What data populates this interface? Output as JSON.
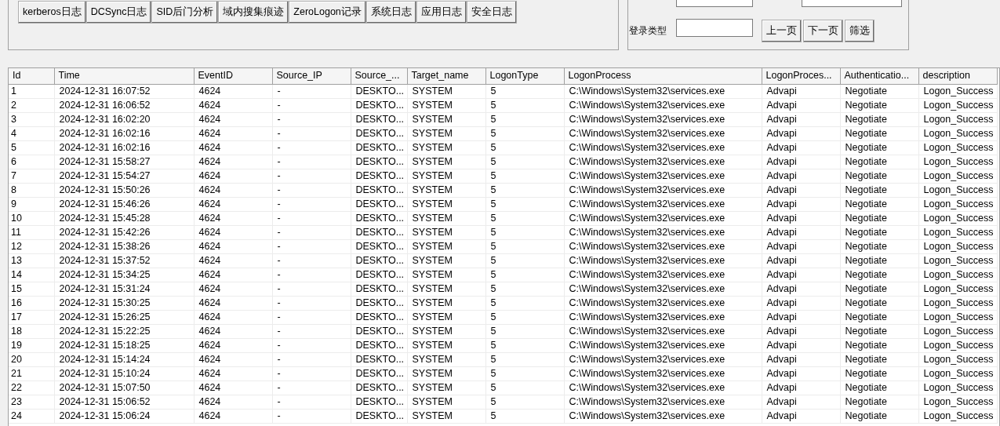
{
  "log_buttons": [
    "kerberos日志",
    "DCSync日志",
    "SID后门分析",
    "域内搜集痕迹",
    "ZeroLogon记录",
    "系统日志",
    "应用日志",
    "安全日志"
  ],
  "filter": {
    "logon_type_label": "登录类型",
    "buttons": [
      "上一页",
      "下一页",
      "筛选"
    ]
  },
  "table": {
    "columns": [
      "Id",
      "Time",
      "EventID",
      "Source_IP",
      "Source_...",
      "Target_name",
      "LogonType",
      "LogonProcess",
      "LogonProces...",
      "Authenticatio...",
      "description"
    ],
    "rows": [
      [
        "1",
        "2024-12-31 16:07:52",
        "4624",
        "-",
        "DESKTO...",
        "SYSTEM",
        "5",
        "C:\\Windows\\System32\\services.exe",
        "Advapi",
        "Negotiate",
        "Logon_Success"
      ],
      [
        "2",
        "2024-12-31 16:06:52",
        "4624",
        "-",
        "DESKTO...",
        "SYSTEM",
        "5",
        "C:\\Windows\\System32\\services.exe",
        "Advapi",
        "Negotiate",
        "Logon_Success"
      ],
      [
        "3",
        "2024-12-31 16:02:20",
        "4624",
        "-",
        "DESKTO...",
        "SYSTEM",
        "5",
        "C:\\Windows\\System32\\services.exe",
        "Advapi",
        "Negotiate",
        "Logon_Success"
      ],
      [
        "4",
        "2024-12-31 16:02:16",
        "4624",
        "-",
        "DESKTO...",
        "SYSTEM",
        "5",
        "C:\\Windows\\System32\\services.exe",
        "Advapi",
        "Negotiate",
        "Logon_Success"
      ],
      [
        "5",
        "2024-12-31 16:02:16",
        "4624",
        "-",
        "DESKTO...",
        "SYSTEM",
        "5",
        "C:\\Windows\\System32\\services.exe",
        "Advapi",
        "Negotiate",
        "Logon_Success"
      ],
      [
        "6",
        "2024-12-31 15:58:27",
        "4624",
        "-",
        "DESKTO...",
        "SYSTEM",
        "5",
        "C:\\Windows\\System32\\services.exe",
        "Advapi",
        "Negotiate",
        "Logon_Success"
      ],
      [
        "7",
        "2024-12-31 15:54:27",
        "4624",
        "-",
        "DESKTO...",
        "SYSTEM",
        "5",
        "C:\\Windows\\System32\\services.exe",
        "Advapi",
        "Negotiate",
        "Logon_Success"
      ],
      [
        "8",
        "2024-12-31 15:50:26",
        "4624",
        "-",
        "DESKTO...",
        "SYSTEM",
        "5",
        "C:\\Windows\\System32\\services.exe",
        "Advapi",
        "Negotiate",
        "Logon_Success"
      ],
      [
        "9",
        "2024-12-31 15:46:26",
        "4624",
        "-",
        "DESKTO...",
        "SYSTEM",
        "5",
        "C:\\Windows\\System32\\services.exe",
        "Advapi",
        "Negotiate",
        "Logon_Success"
      ],
      [
        "10",
        "2024-12-31 15:45:28",
        "4624",
        "-",
        "DESKTO...",
        "SYSTEM",
        "5",
        "C:\\Windows\\System32\\services.exe",
        "Advapi",
        "Negotiate",
        "Logon_Success"
      ],
      [
        "11",
        "2024-12-31 15:42:26",
        "4624",
        "-",
        "DESKTO...",
        "SYSTEM",
        "5",
        "C:\\Windows\\System32\\services.exe",
        "Advapi",
        "Negotiate",
        "Logon_Success"
      ],
      [
        "12",
        "2024-12-31 15:38:26",
        "4624",
        "-",
        "DESKTO...",
        "SYSTEM",
        "5",
        "C:\\Windows\\System32\\services.exe",
        "Advapi",
        "Negotiate",
        "Logon_Success"
      ],
      [
        "13",
        "2024-12-31 15:37:52",
        "4624",
        "-",
        "DESKTO...",
        "SYSTEM",
        "5",
        "C:\\Windows\\System32\\services.exe",
        "Advapi",
        "Negotiate",
        "Logon_Success"
      ],
      [
        "14",
        "2024-12-31 15:34:25",
        "4624",
        "-",
        "DESKTO...",
        "SYSTEM",
        "5",
        "C:\\Windows\\System32\\services.exe",
        "Advapi",
        "Negotiate",
        "Logon_Success"
      ],
      [
        "15",
        "2024-12-31 15:31:24",
        "4624",
        "-",
        "DESKTO...",
        "SYSTEM",
        "5",
        "C:\\Windows\\System32\\services.exe",
        "Advapi",
        "Negotiate",
        "Logon_Success"
      ],
      [
        "16",
        "2024-12-31 15:30:25",
        "4624",
        "-",
        "DESKTO...",
        "SYSTEM",
        "5",
        "C:\\Windows\\System32\\services.exe",
        "Advapi",
        "Negotiate",
        "Logon_Success"
      ],
      [
        "17",
        "2024-12-31 15:26:25",
        "4624",
        "-",
        "DESKTO...",
        "SYSTEM",
        "5",
        "C:\\Windows\\System32\\services.exe",
        "Advapi",
        "Negotiate",
        "Logon_Success"
      ],
      [
        "18",
        "2024-12-31 15:22:25",
        "4624",
        "-",
        "DESKTO...",
        "SYSTEM",
        "5",
        "C:\\Windows\\System32\\services.exe",
        "Advapi",
        "Negotiate",
        "Logon_Success"
      ],
      [
        "19",
        "2024-12-31 15:18:25",
        "4624",
        "-",
        "DESKTO...",
        "SYSTEM",
        "5",
        "C:\\Windows\\System32\\services.exe",
        "Advapi",
        "Negotiate",
        "Logon_Success"
      ],
      [
        "20",
        "2024-12-31 15:14:24",
        "4624",
        "-",
        "DESKTO...",
        "SYSTEM",
        "5",
        "C:\\Windows\\System32\\services.exe",
        "Advapi",
        "Negotiate",
        "Logon_Success"
      ],
      [
        "21",
        "2024-12-31 15:10:24",
        "4624",
        "-",
        "DESKTO...",
        "SYSTEM",
        "5",
        "C:\\Windows\\System32\\services.exe",
        "Advapi",
        "Negotiate",
        "Logon_Success"
      ],
      [
        "22",
        "2024-12-31 15:07:50",
        "4624",
        "-",
        "DESKTO...",
        "SYSTEM",
        "5",
        "C:\\Windows\\System32\\services.exe",
        "Advapi",
        "Negotiate",
        "Logon_Success"
      ],
      [
        "23",
        "2024-12-31 15:06:52",
        "4624",
        "-",
        "DESKTO...",
        "SYSTEM",
        "5",
        "C:\\Windows\\System32\\services.exe",
        "Advapi",
        "Negotiate",
        "Logon_Success"
      ],
      [
        "24",
        "2024-12-31 15:06:24",
        "4624",
        "-",
        "DESKTO...",
        "SYSTEM",
        "5",
        "C:\\Windows\\System32\\services.exe",
        "Advapi",
        "Negotiate",
        "Logon_Success"
      ]
    ]
  }
}
